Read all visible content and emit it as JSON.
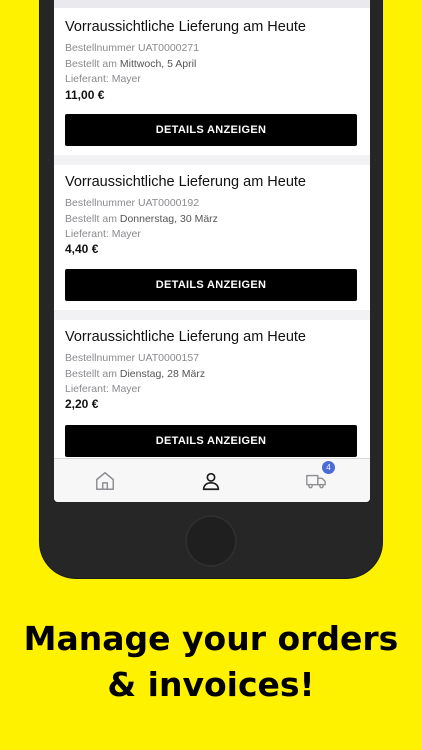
{
  "orders": [
    {
      "title": "Vorraussichtliche Lieferung am Heute",
      "order_number": "Bestellnummer UAT0000271",
      "ordered_prefix": "Bestellt am ",
      "ordered_date": "Mittwoch, 5 April",
      "supplier": "Lieferant: Mayer",
      "price": "11,00 €",
      "button_label": "DETAILS ANZEIGEN"
    },
    {
      "title": "Vorraussichtliche Lieferung am Heute",
      "order_number": "Bestellnummer UAT0000192",
      "ordered_prefix": "Bestellt am ",
      "ordered_date": "Donnerstag, 30 März",
      "supplier": "Lieferant: Mayer",
      "price": "4,40 €",
      "button_label": "DETAILS ANZEIGEN"
    },
    {
      "title": "Vorraussichtliche Lieferung am Heute",
      "order_number": "Bestellnummer UAT0000157",
      "ordered_prefix": "Bestellt am ",
      "ordered_date": "Dienstag, 28 März",
      "supplier": "Lieferant: Mayer",
      "price": "2,20 €",
      "button_label": "DETAILS ANZEIGEN"
    }
  ],
  "tabbar": {
    "tabs": [
      {
        "icon": "home-icon",
        "active": false
      },
      {
        "icon": "user-icon",
        "active": true
      },
      {
        "icon": "truck-icon",
        "active": false,
        "badge": "4"
      }
    ]
  },
  "marketing": {
    "line1": "Manage your orders",
    "line2": "& invoices!"
  },
  "colors": {
    "background": "#fff200",
    "button": "#000000",
    "badge": "#4a6cd4"
  }
}
